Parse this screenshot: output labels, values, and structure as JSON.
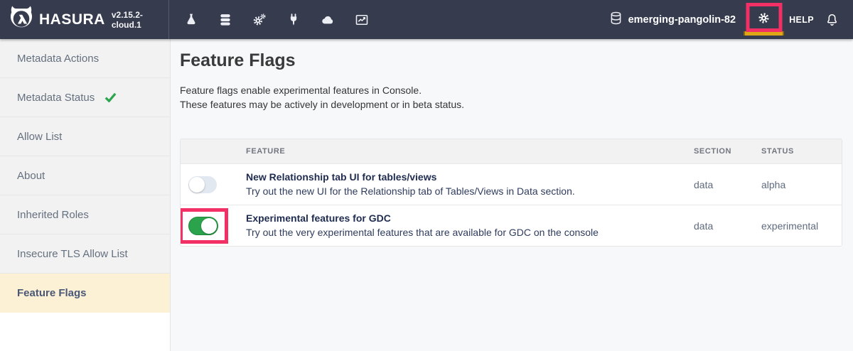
{
  "navbar": {
    "brand": "HASURA",
    "version": "v2.15.2-cloud.1",
    "nav_icons": [
      "api-flask-icon",
      "data-database-icon",
      "actions-cogs-icon",
      "remote-schemas-plug-icon",
      "events-cloud-icon",
      "monitoring-chart-icon"
    ],
    "project_name": "emerging-pangolin-82",
    "help_label": "HELP"
  },
  "sidebar": {
    "items": [
      {
        "label": "Metadata Actions",
        "active": false,
        "check": false
      },
      {
        "label": "Metadata Status",
        "active": false,
        "check": true
      },
      {
        "label": "Allow List",
        "active": false,
        "check": false
      },
      {
        "label": "About",
        "active": false,
        "check": false
      },
      {
        "label": "Inherited Roles",
        "active": false,
        "check": false
      },
      {
        "label": "Insecure TLS Allow List",
        "active": false,
        "check": false
      },
      {
        "label": "Feature Flags",
        "active": true,
        "check": false
      }
    ]
  },
  "main": {
    "title": "Feature Flags",
    "description1": "Feature flags enable experimental features in Console.",
    "description2": "These features may be actively in development or in beta status.",
    "table": {
      "headers": {
        "feature": "FEATURE",
        "section": "SECTION",
        "status": "STATUS"
      },
      "rows": [
        {
          "toggle_on": false,
          "highlighted": false,
          "title": "New Relationship tab UI for tables/views",
          "description": "Try out the new UI for the Relationship tab of Tables/Views in Data section.",
          "section": "data",
          "status": "alpha"
        },
        {
          "toggle_on": true,
          "highlighted": true,
          "title": "Experimental features for GDC",
          "description": "Try out the very experimental features that are available for GDC on the console",
          "section": "data",
          "status": "experimental"
        }
      ]
    }
  },
  "colors": {
    "navbar_bg": "#363b4e",
    "annotation_pink": "#f23066",
    "active_indicator_amber": "#dfa615",
    "toggle_on_green": "#2ba24c",
    "toggle_off_gray": "#e2e8f0",
    "check_green": "#2da44e",
    "sidebar_active_bg": "#fdf1d5"
  }
}
